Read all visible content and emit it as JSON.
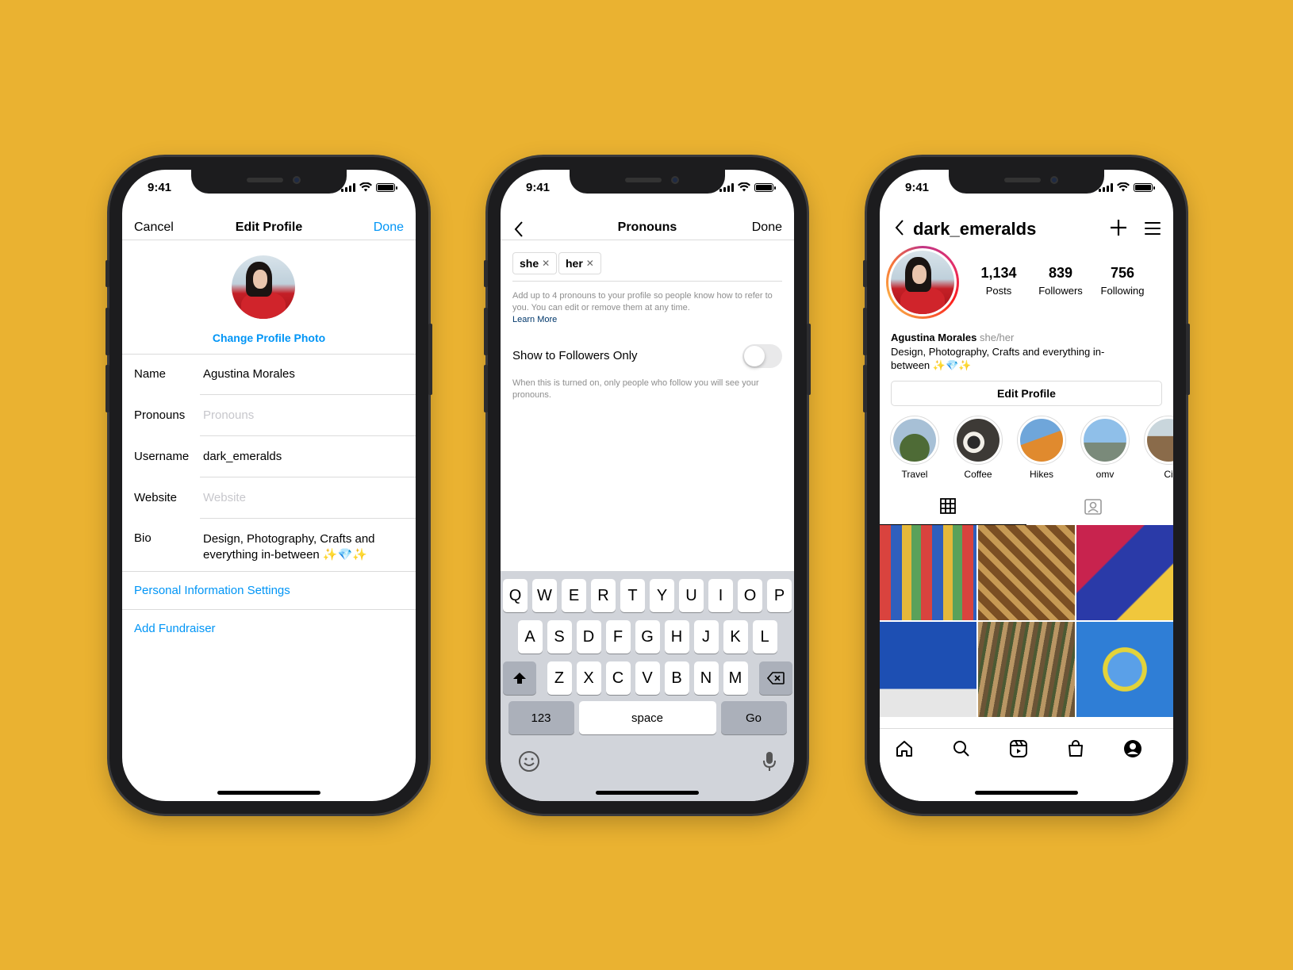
{
  "status": {
    "time": "9:41"
  },
  "edit_profile": {
    "cancel": "Cancel",
    "title": "Edit Profile",
    "done": "Done",
    "change_photo": "Change Profile Photo",
    "fields": [
      {
        "label": "Name",
        "value": "Agustina Morales",
        "placeholder": ""
      },
      {
        "label": "Pronouns",
        "value": "",
        "placeholder": "Pronouns"
      },
      {
        "label": "Username",
        "value": "dark_emeralds",
        "placeholder": ""
      },
      {
        "label": "Website",
        "value": "",
        "placeholder": "Website"
      },
      {
        "label": "Bio",
        "value": "Design, Photography, Crafts and everything in-between ✨💎✨",
        "placeholder": ""
      }
    ],
    "personal_info": "Personal Information Settings",
    "add_fundraiser": "Add Fundraiser"
  },
  "pronouns": {
    "title": "Pronouns",
    "done": "Done",
    "chips": [
      "she",
      "her"
    ],
    "help": "Add up to 4 pronouns to your profile so people know how to refer to you. You can edit or remove them at any time.",
    "learn_more": "Learn More",
    "toggle_label": "Show to Followers Only",
    "toggle_on": false,
    "toggle_help": "When this is turned on, only people who follow you will see your pronouns.",
    "keyboard": {
      "row1": [
        "Q",
        "W",
        "E",
        "R",
        "T",
        "Y",
        "U",
        "I",
        "O",
        "P"
      ],
      "row2": [
        "A",
        "S",
        "D",
        "F",
        "G",
        "H",
        "J",
        "K",
        "L"
      ],
      "row3": [
        "Z",
        "X",
        "C",
        "V",
        "B",
        "N",
        "M"
      ],
      "numbers": "123",
      "space": "space",
      "go": "Go"
    }
  },
  "profile": {
    "username": "dark_emeralds",
    "stats": [
      {
        "num": "1,134",
        "label": "Posts"
      },
      {
        "num": "839",
        "label": "Followers"
      },
      {
        "num": "756",
        "label": "Following"
      }
    ],
    "name": "Agustina Morales",
    "pronouns": "she/her",
    "bio": "Design, Photography, Crafts and everything in-between ✨💎✨",
    "edit_button": "Edit Profile",
    "highlights": [
      {
        "label": "Travel",
        "color": "#6f8a4f"
      },
      {
        "label": "Coffee",
        "color": "#3d3a36"
      },
      {
        "label": "Hikes",
        "color": "#d9822b"
      },
      {
        "label": "omv",
        "color": "#6fa3d6"
      },
      {
        "label": "Ci",
        "color": "#8a6b4a"
      }
    ],
    "grid_colors": [
      "#c14b6b",
      "#8a5b2e",
      "#2b3c9e",
      "#1d4fb3",
      "#8c7a55",
      "#2f7ed6"
    ]
  }
}
